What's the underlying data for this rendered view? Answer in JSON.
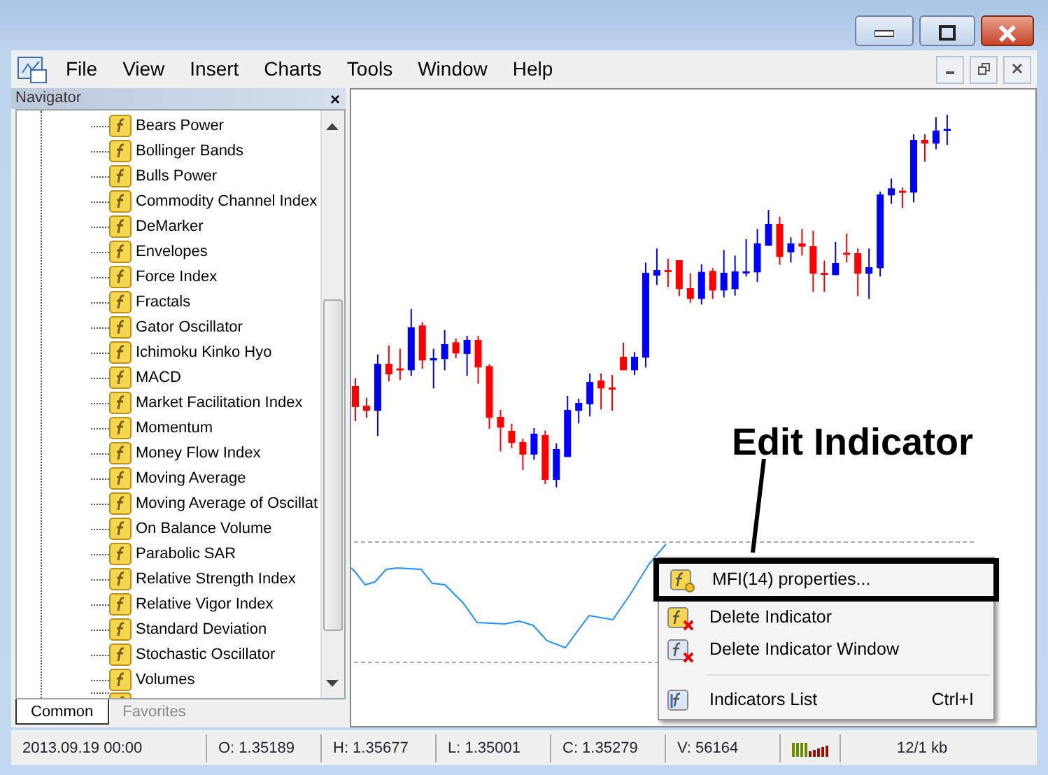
{
  "menu": [
    "File",
    "View",
    "Insert",
    "Charts",
    "Tools",
    "Window",
    "Help"
  ],
  "navigator": {
    "title": "Navigator",
    "close": "×",
    "items": [
      "Bears Power",
      "Bollinger Bands",
      "Bulls Power",
      "Commodity Channel Index",
      "DeMarker",
      "Envelopes",
      "Force Index",
      "Fractals",
      "Gator Oscillator",
      "Ichimoku Kinko Hyo",
      "MACD",
      "Market Facilitation Index",
      "Momentum",
      "Money Flow Index",
      "Moving Average",
      "Moving Average of Oscillat",
      "On Balance Volume",
      "Parabolic SAR",
      "Relative Strength Index",
      "Relative Vigor Index",
      "Standard Deviation",
      "Stochastic Oscillator",
      "Volumes"
    ],
    "tabs": [
      {
        "label": "Common",
        "selected": true
      },
      {
        "label": "Favorites",
        "selected": false
      }
    ]
  },
  "annotation": {
    "text": "Edit Indicator"
  },
  "context_menu": {
    "items": [
      {
        "kind": "item",
        "label": "MFI(14) properties...",
        "outlined": true
      },
      {
        "kind": "item",
        "label": "Delete Indicator",
        "outlined": false
      },
      {
        "kind": "item",
        "label": "Delete Indicator Window",
        "outlined": false
      },
      {
        "kind": "separator"
      },
      {
        "kind": "item",
        "label": "Indicators List",
        "shortcut": "Ctrl+I",
        "outlined": false
      }
    ]
  },
  "status_bar": [
    "2013.09.19 00:00",
    "O: 1.35189",
    "H: 1.35677",
    "L: 1.35001",
    "C: 1.35279",
    "V: 56164",
    "12/1 kb"
  ]
}
